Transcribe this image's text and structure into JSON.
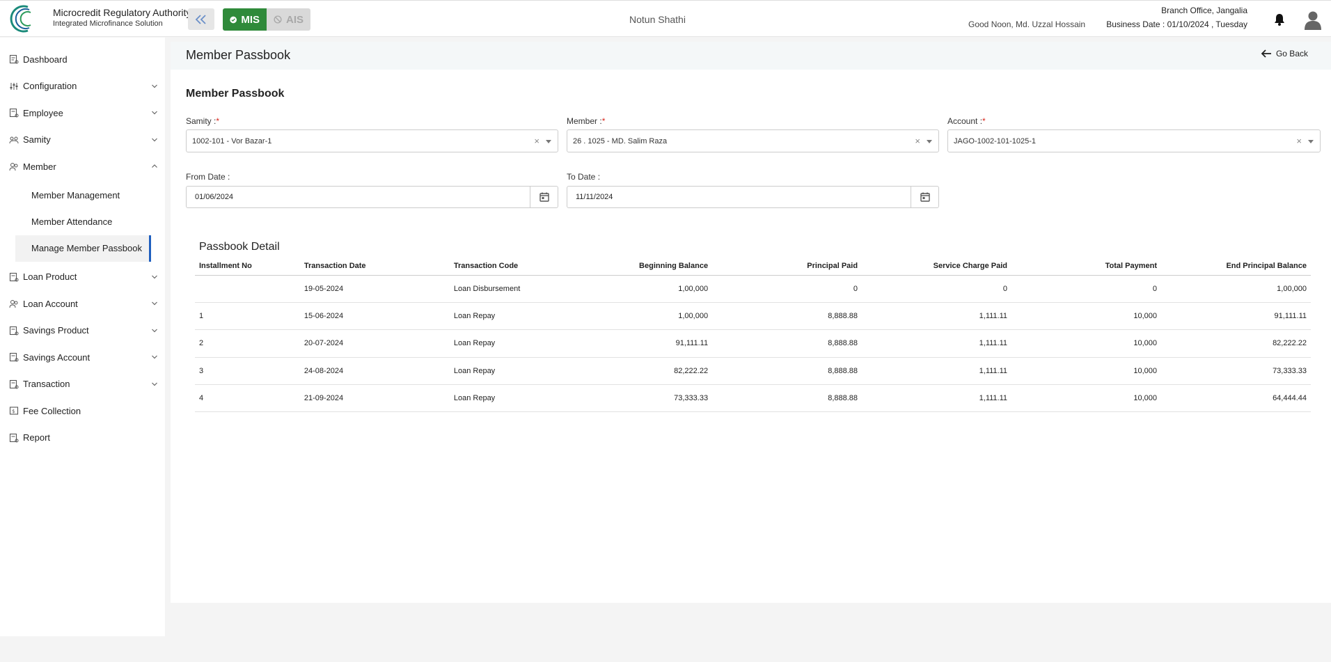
{
  "header": {
    "brand_title": "Microcredit Regulatory Authority",
    "brand_subtitle": "Integrated Microfinance Solution",
    "logo_text": "Microcredit Regulatory Authority",
    "modes": {
      "mis": "MIS",
      "ais": "AIS"
    },
    "org_name": "Notun Shathi",
    "greeting": "Good Noon, Md. Uzzal Hossain",
    "branch": "Branch Office, Jangalia",
    "business_date": "Business Date : 01/10/2024 , Tuesday"
  },
  "sidebar": {
    "items": [
      {
        "label": "Dashboard",
        "icon": "dashboard-icon",
        "chevron": false
      },
      {
        "label": "Configuration",
        "icon": "sliders-icon",
        "chevron": "down"
      },
      {
        "label": "Employee",
        "icon": "employee-icon",
        "chevron": "down"
      },
      {
        "label": "Samity",
        "icon": "samity-icon",
        "chevron": "down"
      },
      {
        "label": "Member",
        "icon": "member-icon",
        "chevron": "up"
      }
    ],
    "member_sub": [
      {
        "label": "Member Management"
      },
      {
        "label": "Member Attendance"
      },
      {
        "label": "Manage Member Passbook",
        "active": true
      }
    ],
    "items_after": [
      {
        "label": "Loan Product",
        "icon": "loan-product-icon",
        "chevron": "down"
      },
      {
        "label": "Loan Account",
        "icon": "loan-account-icon",
        "chevron": "down"
      },
      {
        "label": "Savings Product",
        "icon": "savings-product-icon",
        "chevron": "down"
      },
      {
        "label": "Savings Account",
        "icon": "savings-account-icon",
        "chevron": "down"
      },
      {
        "label": "Transaction",
        "icon": "transaction-icon",
        "chevron": "down"
      },
      {
        "label": "Fee Collection",
        "icon": "fee-icon",
        "chevron": false
      },
      {
        "label": "Report",
        "icon": "report-icon",
        "chevron": false
      }
    ]
  },
  "page": {
    "title": "Member Passbook",
    "go_back": "Go Back",
    "section_title": "Member Passbook"
  },
  "form": {
    "samity": {
      "label": "Samity :",
      "required": "*",
      "value": "1002-101 - Vor Bazar-1"
    },
    "member": {
      "label": "Member :",
      "required": "*",
      "value": "26 . 1025 - MD. Salim Raza"
    },
    "account": {
      "label": "Account :",
      "required": "*",
      "value": "JAGO-1002-101-1025-1"
    },
    "from_date": {
      "label": "From Date :",
      "value": "01/06/2024"
    },
    "to_date": {
      "label": "To Date :",
      "value": "11/11/2024"
    },
    "clear_glyph": "×"
  },
  "passbook": {
    "title": "Passbook Detail",
    "columns": [
      "Installment No",
      "Transaction Date",
      "Transaction Code",
      "Beginning Balance",
      "Principal Paid",
      "Service Charge Paid",
      "Total Payment",
      "End Principal Balance"
    ],
    "rows": [
      [
        "",
        "19-05-2024",
        "Loan Disbursement",
        "1,00,000",
        "0",
        "0",
        "0",
        "1,00,000"
      ],
      [
        "1",
        "15-06-2024",
        "Loan Repay",
        "1,00,000",
        "8,888.88",
        "1,111.11",
        "10,000",
        "91,111.11"
      ],
      [
        "2",
        "20-07-2024",
        "Loan Repay",
        "91,111.11",
        "8,888.88",
        "1,111.11",
        "10,000",
        "82,222.22"
      ],
      [
        "3",
        "24-08-2024",
        "Loan Repay",
        "82,222.22",
        "8,888.88",
        "1,111.11",
        "10,000",
        "73,333.33"
      ],
      [
        "4",
        "21-09-2024",
        "Loan Repay",
        "73,333.33",
        "8,888.88",
        "1,111.11",
        "10,000",
        "64,444.44"
      ]
    ]
  },
  "colors": {
    "accent_green": "#2f8a3a",
    "active_bar": "#1f5fbf",
    "required": "#d9261c"
  }
}
